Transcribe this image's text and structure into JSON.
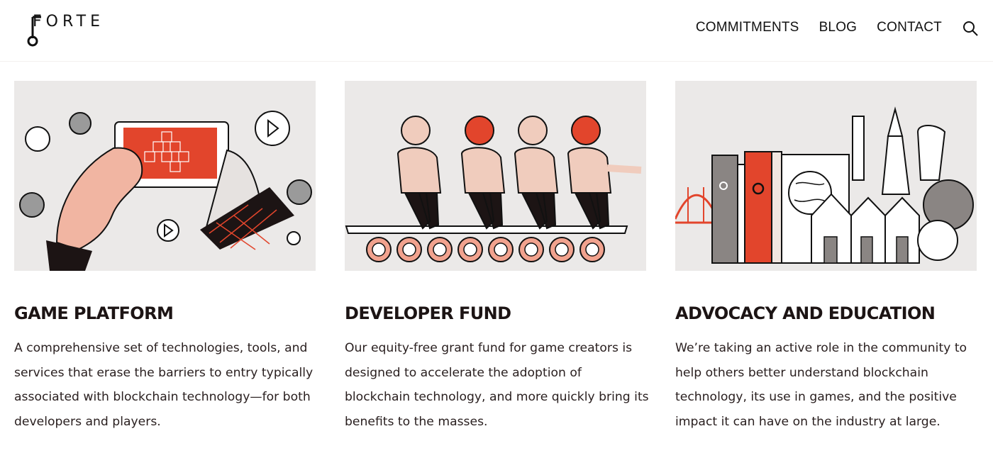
{
  "brand": {
    "name": "FORTE"
  },
  "nav": {
    "items": [
      "COMMITMENTS",
      "BLOG",
      "CONTACT"
    ]
  },
  "colors": {
    "accent": "#e2452c",
    "skin": "#f1b5a2",
    "ink": "#1c1414",
    "panel": "#ebe9e8"
  },
  "cards": [
    {
      "title": "GAME PLATFORM",
      "icon": "hands-holding-phone-blockchain-illustration",
      "text": "A comprehensive set of technologies, tools, and services that erase the barriers to entry typically associated with blockchain technology—for both developers and players."
    },
    {
      "title": "DEVELOPER FUND",
      "icon": "people-on-conveyor-belt-illustration",
      "text": "Our equity-free grant fund for game creators is designed to accelerate the adoption of blockchain technology, and more quickly bring its benefits to the masses."
    },
    {
      "title": "ADVOCACY AND EDUCATION",
      "icon": "books-and-city-illustration",
      "text": "We’re taking an active role in the community to help others better understand blockchain technology, its use in games, and the positive impact it can have on the industry at large."
    }
  ]
}
